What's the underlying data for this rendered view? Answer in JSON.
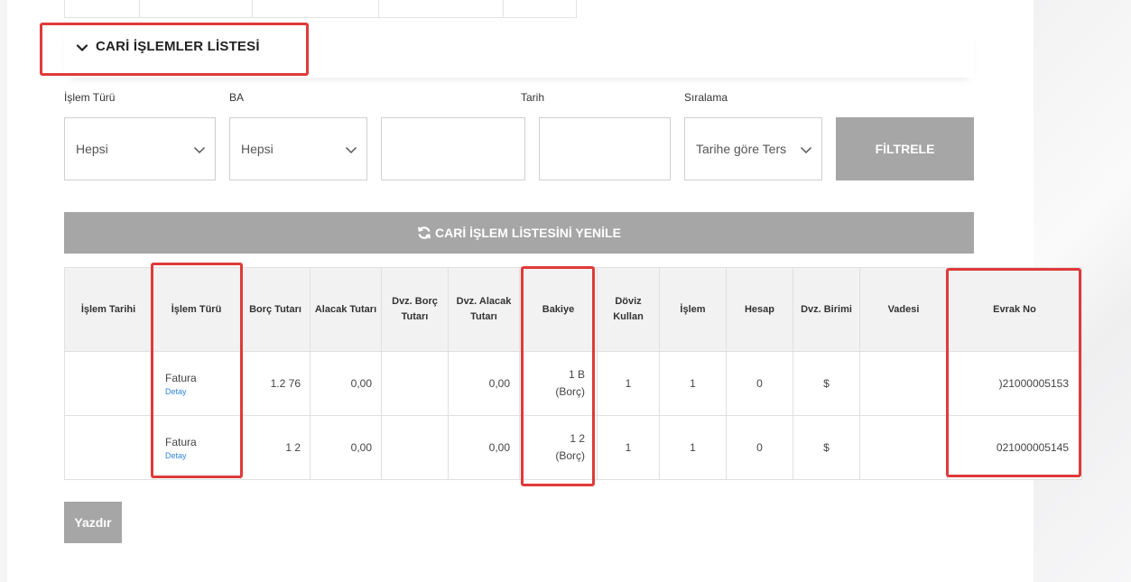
{
  "section": {
    "title": "CARİ İŞLEMLER LİSTESİ"
  },
  "filters": {
    "islem_turu": {
      "label": "İşlem Türü",
      "value": "Hepsi"
    },
    "ba": {
      "label": "BA",
      "value": "Hepsi"
    },
    "tarih_start": {
      "value": ""
    },
    "tarih": {
      "label": "Tarih",
      "value": ""
    },
    "siralama": {
      "label": "Sıralama",
      "value": "Tarihe göre Ters"
    },
    "filter_button": "FİLTRELE"
  },
  "refresh_button": "CARİ İŞLEM LİSTESİNİ YENİLE",
  "table": {
    "headers": [
      "İşlem Tarihi",
      "İşlem Türü",
      "Borç Tutarı",
      "Alacak Tutarı",
      "Dvz. Borç Tutarı",
      "Dvz. Alacak Tutarı",
      "Bakiye",
      "Döviz Kullan",
      "İşlem",
      "Hesap",
      "Dvz. Birimi",
      "Vadesi",
      "Evrak No"
    ],
    "rows": [
      {
        "islem_tarihi": "",
        "islem_turu": "Fatura",
        "detay": "Detay",
        "borc": "1.2 76",
        "alacak": "0,00",
        "dvz_borc": "",
        "dvz_alacak": "0,00",
        "bakiye": "1 B",
        "bakiye_suffix": "(Borç)",
        "doviz_kullan": "1",
        "islem": "1",
        "hesap": "0",
        "dvz_birimi": "$",
        "vadesi": "",
        "evrak_no": ")21000005153"
      },
      {
        "islem_tarihi": "",
        "islem_turu": "Fatura",
        "detay": "Detay",
        "borc": "1 2",
        "alacak": "0,00",
        "dvz_borc": "",
        "dvz_alacak": "0,00",
        "bakiye": "1 2",
        "bakiye_suffix": "(Borç)",
        "doviz_kullan": "1",
        "islem": "1",
        "hesap": "0",
        "dvz_birimi": "$",
        "vadesi": "",
        "evrak_no": "021000005145"
      }
    ]
  },
  "print_button": "Yazdır",
  "icons": {
    "chevron": "chevron-down-icon",
    "refresh": "refresh-icon",
    "dropdown": "chevron-down-icon"
  },
  "colors": {
    "button_gray": "#a6a6a6",
    "highlight_red": "#e03a3a",
    "link_blue": "#2e86de"
  }
}
